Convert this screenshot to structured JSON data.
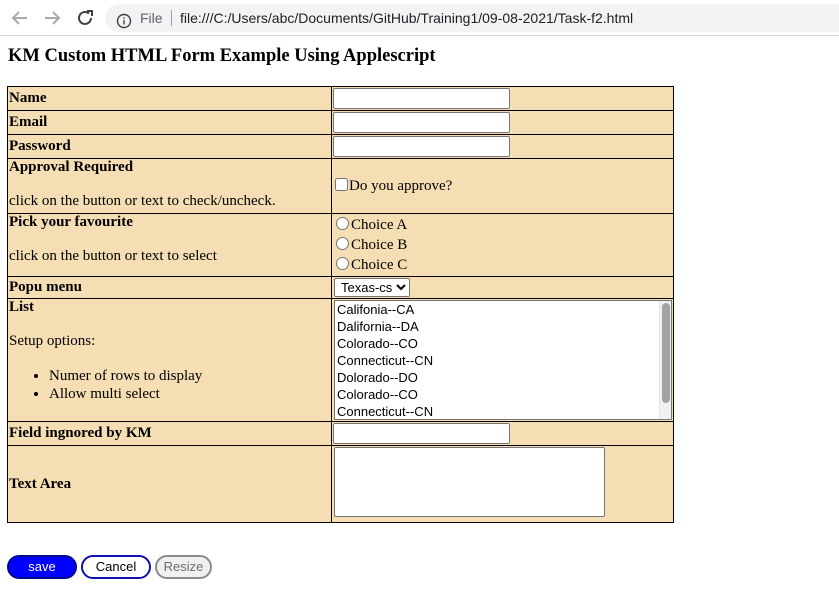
{
  "browser": {
    "file_label": "File",
    "url": "file:///C:/Users/abc/Documents/GitHub/Training1/09-08-2021/Task-f2.html"
  },
  "page": {
    "title": "KM Custom HTML Form Example Using Applescript"
  },
  "form": {
    "name_label": "Name",
    "email_label": "Email",
    "password_label": "Password",
    "approval": {
      "label": "Approval Required",
      "hint": "click on the button or text to check/uncheck.",
      "checkbox_text": "Do you approve?"
    },
    "favourite": {
      "label": "Pick your favourite",
      "hint": "click on the button or text to select",
      "choices": [
        "Choice A",
        "Choice B",
        "Choice C"
      ]
    },
    "popup": {
      "label": "Popu menu",
      "selected": "Texas-cs"
    },
    "list": {
      "label": "List",
      "setup": "Setup options:",
      "bullets": [
        "Numer of rows to display",
        "Allow multi select"
      ],
      "options": [
        "Califonia--CA",
        "Dalifornia--DA",
        "Colorado--CO",
        "Connecticut--CN",
        "Dolorado--DO",
        "Colorado--CO",
        "Connecticut--CN"
      ]
    },
    "ignored_label": "Field ingnored by KM",
    "textarea_label": "Text Area"
  },
  "buttons": {
    "save": "save",
    "cancel": "Cancel",
    "resize": "Resize"
  }
}
